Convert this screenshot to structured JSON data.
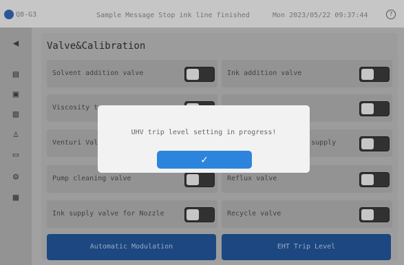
{
  "topbar": {
    "device": "Q8-G3",
    "message": "Sample Message Stop ink line finished",
    "datetime": "Mon 2023/05/22 09:37:44"
  },
  "panel": {
    "title": "Valve&Calibration"
  },
  "rows": [
    {
      "left": "Solvent addition valve",
      "right": "Ink addition valve"
    },
    {
      "left": "Viscosity t",
      "right": ""
    },
    {
      "left": "Venturi Val",
      "right": "ink supply"
    },
    {
      "left": "Pump cleaning valve",
      "right": "Reflux valve"
    },
    {
      "left": "Ink supply valve for Nozzle",
      "right": "Recycle valve"
    }
  ],
  "buttons": {
    "auto_mod": "Automatic Modulation",
    "eht_trip": "EHT Trip Level"
  },
  "dialog": {
    "message": "UHV trip level setting in progress!",
    "ok_glyph": "✓"
  },
  "colors": {
    "primary_button": "#1f4a86",
    "ok_button": "#2d84dd"
  }
}
